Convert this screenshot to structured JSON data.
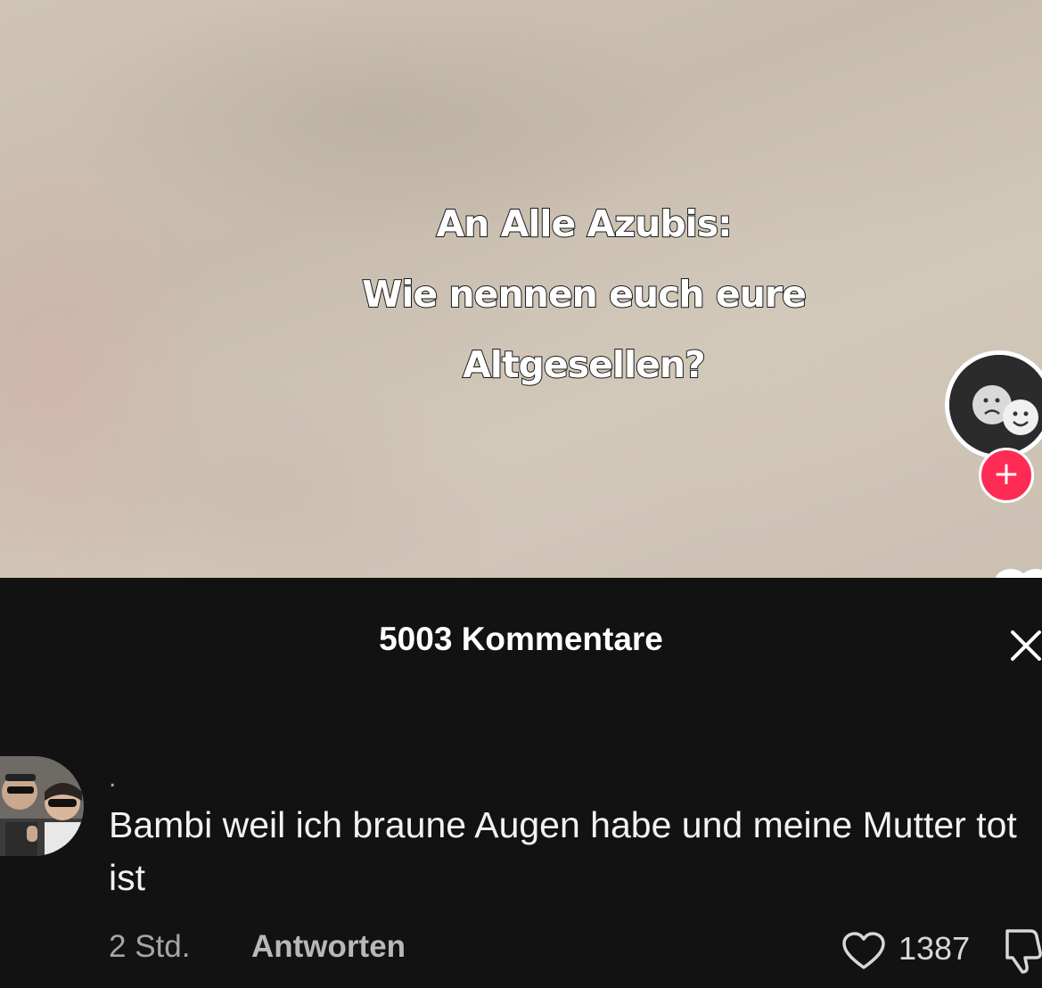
{
  "video": {
    "overlay_lines": [
      "An Alle Azubis:",
      "Wie nennen euch eure",
      "Altgesellen?"
    ],
    "follow_icon": "plus-icon"
  },
  "comments_panel": {
    "title": "5003 Kommentare",
    "close_icon": "close-icon",
    "comment": {
      "user_name": ".",
      "text": "Bambi weil ich braune Augen habe und meine Mutter tot ist",
      "time": "2 Std.",
      "reply_label": "Antworten",
      "like_count": "1387",
      "like_icon": "heart-outline-icon",
      "dislike_icon": "thumbs-down-icon"
    }
  },
  "colors": {
    "panel_background": "#121212",
    "follow_accent": "#fe2c55",
    "text_primary": "#ffffff",
    "text_secondary": "#a6a6a6"
  }
}
